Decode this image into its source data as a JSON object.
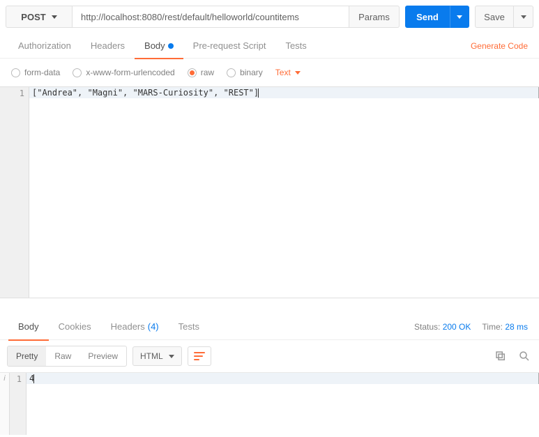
{
  "request": {
    "method": "POST",
    "url": "http://localhost:8080/rest/default/helloworld/countitems",
    "params_label": "Params",
    "send_label": "Send",
    "save_label": "Save"
  },
  "req_tabs": {
    "authorization": "Authorization",
    "headers": "Headers",
    "body": "Body",
    "prerequest": "Pre-request Script",
    "tests": "Tests",
    "generate_code": "Generate Code"
  },
  "body_opts": {
    "form_data": "form-data",
    "urlencoded": "x-www-form-urlencoded",
    "raw": "raw",
    "binary": "binary",
    "format": "Text"
  },
  "request_body": {
    "line1_num": "1",
    "content": "[\"Andrea\", \"Magni\", \"MARS-Curiosity\", \"REST\"]"
  },
  "resp_tabs": {
    "body": "Body",
    "cookies": "Cookies",
    "headers": "Headers",
    "headers_count": "(4)",
    "tests": "Tests"
  },
  "status": {
    "status_label": "Status:",
    "status_value": "200 OK",
    "time_label": "Time:",
    "time_value": "28 ms"
  },
  "view": {
    "pretty": "Pretty",
    "raw": "Raw",
    "preview": "Preview",
    "lang": "HTML"
  },
  "response_body": {
    "line1_num": "1",
    "content": "4"
  }
}
